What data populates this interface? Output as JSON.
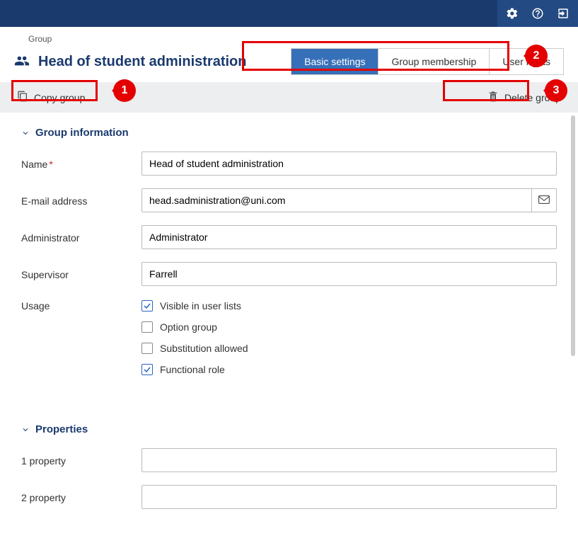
{
  "topbar": {
    "settings_icon": "gear-icon",
    "help_icon": "help-icon",
    "logout_icon": "logout-icon"
  },
  "breadcrumb": "Group",
  "page_title": "Head of student administration",
  "tabs": {
    "basic": "Basic settings",
    "membership": "Group membership",
    "rights": "User rights"
  },
  "toolbar": {
    "copy": "Copy group",
    "delete": "Delete group"
  },
  "sections": {
    "info_title": "Group information",
    "props_title": "Properties"
  },
  "fields": {
    "name_label": "Name",
    "name_value": "Head of student administration",
    "email_label": "E-mail address",
    "email_value": "head.sadministration@uni.com",
    "admin_label": "Administrator",
    "admin_value": "Administrator",
    "supervisor_label": "Supervisor",
    "supervisor_value": "Farrell",
    "usage_label": "Usage",
    "prop1_label": "1 property",
    "prop1_value": "",
    "prop2_label": "2 property",
    "prop2_value": ""
  },
  "usage": {
    "visible": "Visible in user lists",
    "option": "Option group",
    "substitution": "Substitution allowed",
    "functional": "Functional role"
  },
  "annotations": {
    "n1": "1",
    "n2": "2",
    "n3": "3"
  }
}
